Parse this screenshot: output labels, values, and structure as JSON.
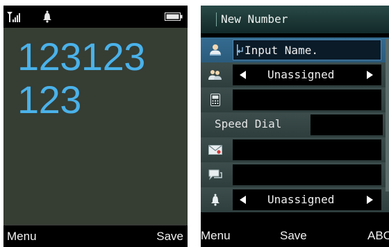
{
  "left_screen": {
    "dialed_lines": [
      "123123",
      "123"
    ],
    "softkeys": {
      "left": "Menu",
      "right": "Save"
    }
  },
  "right_screen": {
    "title": "New Number",
    "rows": [
      {
        "icon": "person-icon",
        "value": "Input Name."
      },
      {
        "icon": "group-icon",
        "value": "Unassigned"
      },
      {
        "icon": "phone-icon",
        "value": ""
      },
      {
        "label": "Speed Dial",
        "value": ""
      },
      {
        "icon": "envelope-icon",
        "value": ""
      },
      {
        "icon": "speech-bubble-icon",
        "value": ""
      },
      {
        "icon": "bell-icon",
        "value": "Unassigned"
      }
    ],
    "softkeys": {
      "left": "Menu",
      "center": "Save",
      "right": "ABC"
    }
  },
  "colors": {
    "digit": "#4ab2ea",
    "selected_row": "#356c91",
    "left_background": "#363d33"
  }
}
